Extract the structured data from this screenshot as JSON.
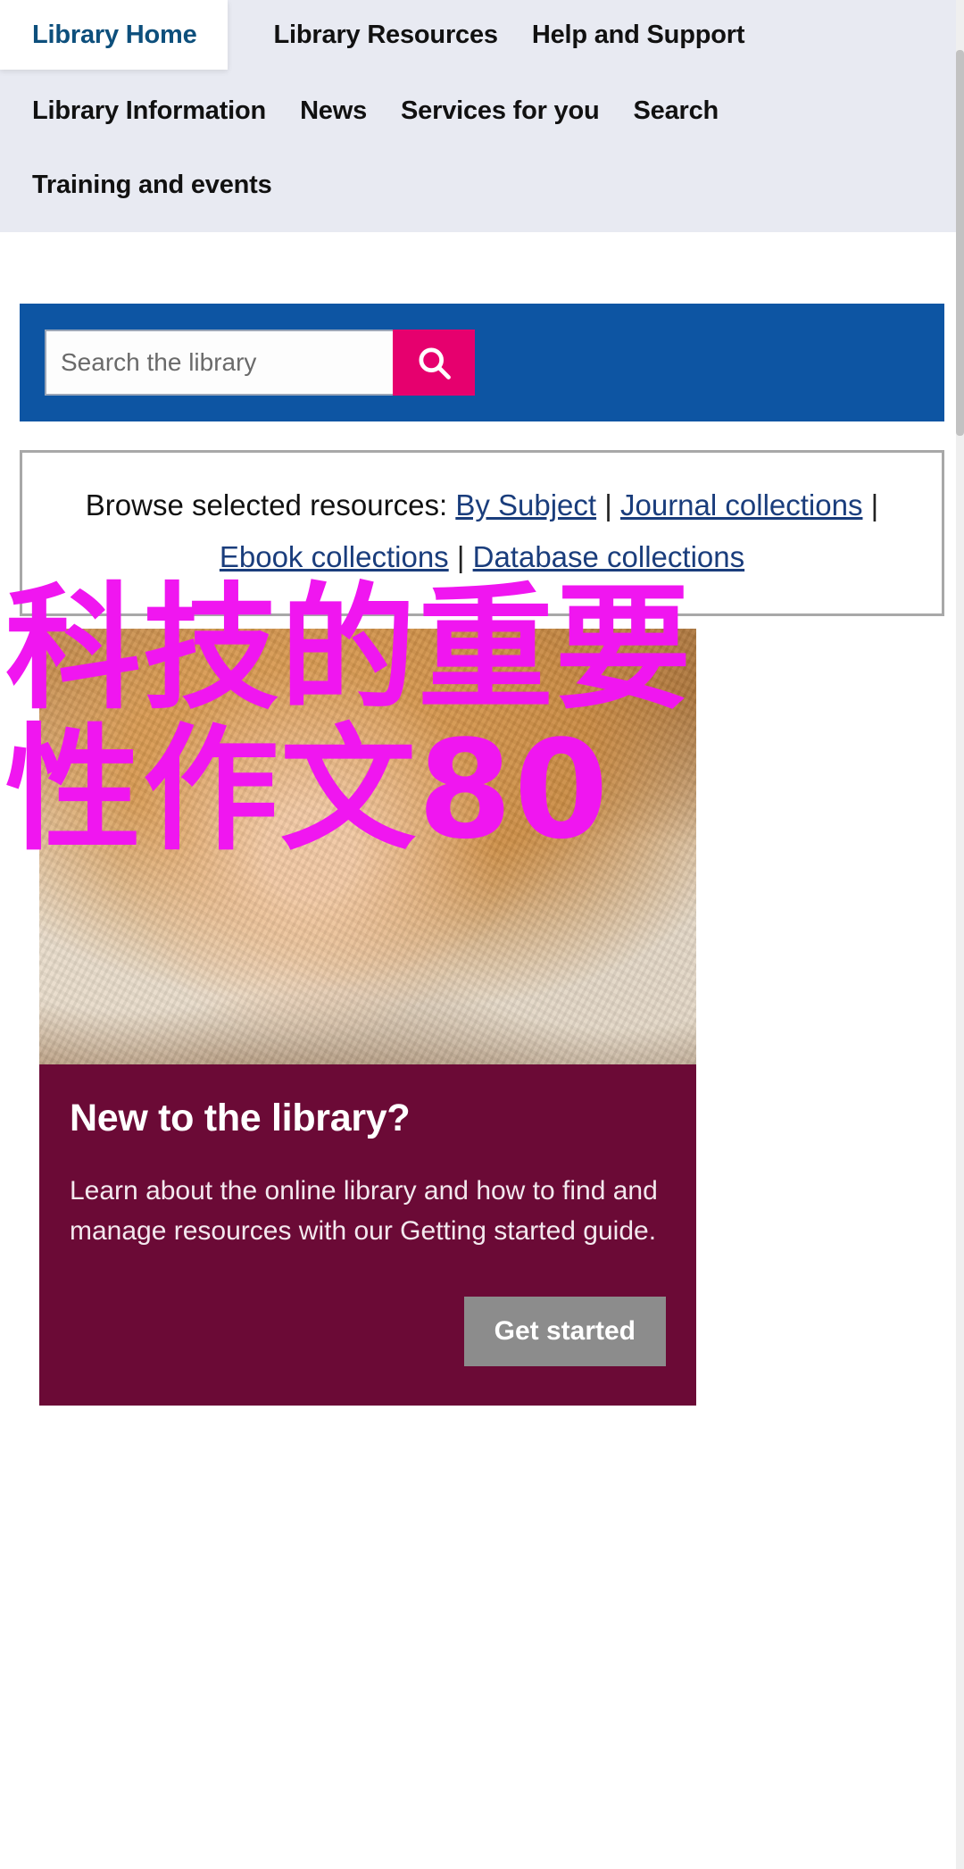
{
  "nav": {
    "rows": [
      [
        {
          "label": "Library Home",
          "active": true
        },
        {
          "label": "Library Resources",
          "active": false
        },
        {
          "label": "Help and Support",
          "active": false
        }
      ],
      [
        {
          "label": "Library Information",
          "active": false
        },
        {
          "label": "News",
          "active": false
        },
        {
          "label": "Services for you",
          "active": false
        },
        {
          "label": "Search",
          "active": false
        }
      ],
      [
        {
          "label": "Training and events",
          "active": false
        }
      ]
    ]
  },
  "search": {
    "placeholder": "Search the library",
    "value": "",
    "button_icon": "search-icon",
    "band_color": "#0d55a3",
    "button_color": "#e6006e"
  },
  "browse": {
    "label": "Browse selected resources:",
    "separator": "|",
    "links": [
      "By Subject",
      "Journal collections",
      "Ebook collections",
      "Database collections"
    ]
  },
  "hero": {
    "image_alt": "smiling-person-with-phone-photo",
    "title": "New to the library?",
    "body": "Learn about the online library and how to find and manage resources with our Getting started guide.",
    "button_label": "Get started",
    "background_color": "#6b0a36",
    "button_color": "#8c8c8c"
  },
  "overlay": {
    "color": "#f016f0",
    "lines": [
      "科技的重要",
      "性作文80"
    ]
  }
}
